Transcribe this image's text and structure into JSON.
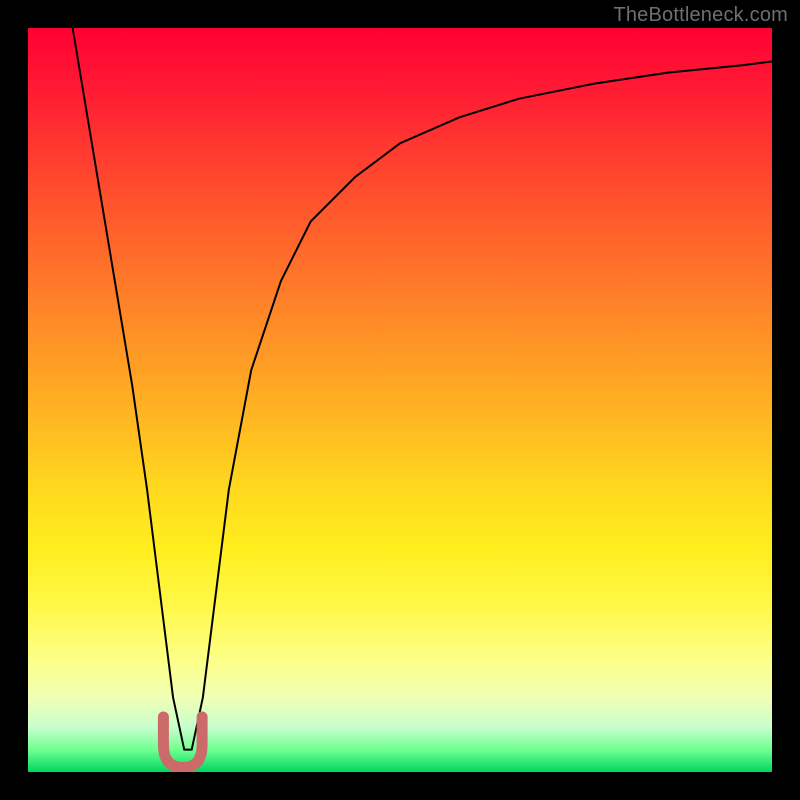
{
  "watermark": "TheBottleneck.com",
  "chart_data": {
    "type": "line",
    "title": "",
    "xlabel": "",
    "ylabel": "",
    "xlim": [
      0,
      100
    ],
    "ylim": [
      0,
      100
    ],
    "grid": false,
    "legend": false,
    "series": [
      {
        "name": "bottleneck-curve",
        "color": "#000000",
        "x": [
          6,
          8,
          10,
          12,
          14,
          16,
          18,
          19.5,
          21,
          22,
          23.5,
          25,
          27,
          30,
          34,
          38,
          44,
          50,
          58,
          66,
          76,
          86,
          96,
          100
        ],
        "y": [
          100,
          88,
          76,
          64,
          52,
          38,
          22,
          10,
          3,
          3,
          10,
          22,
          38,
          54,
          66,
          74,
          80,
          84.5,
          88,
          90.5,
          92.5,
          94,
          95,
          95.5
        ]
      },
      {
        "name": "sweet-spot-marker",
        "type": "overlay",
        "color": "#cc6a6a",
        "cx": 20.8,
        "cy": 4,
        "rx": 2.6,
        "ry": 3.4
      }
    ],
    "gradient_stops": [
      {
        "pos": 0,
        "color": "#ff0033"
      },
      {
        "pos": 50,
        "color": "#ffc020"
      },
      {
        "pos": 80,
        "color": "#fff84a"
      },
      {
        "pos": 100,
        "color": "#00d760"
      }
    ]
  }
}
